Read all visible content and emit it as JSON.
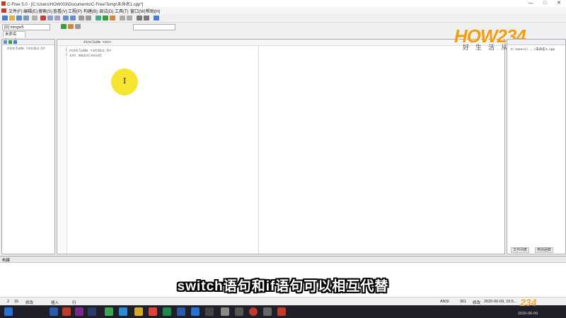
{
  "window": {
    "title": "C-Free 5.0 - [C:\\Users\\HOW003\\Documents\\C-Free\\Temp\\未命名1.cpp*]",
    "controls": [
      "—",
      "□",
      "✕"
    ]
  },
  "menu": {
    "items": [
      "文件(F)",
      "编辑(E)",
      "搜索(S)",
      "查看(V)",
      "工程(P)",
      "构建(B)",
      "调试(D)",
      "工具(T)",
      "窗口(W)",
      "帮助(H)"
    ]
  },
  "compiler_select": {
    "value": "[D] mingw5"
  },
  "file_tab": {
    "label": "未命名1.cpp*"
  },
  "left_panel": {
    "tree_item": "#include <stdio.h>"
  },
  "editor": {
    "scope_select": "#include <st>",
    "lines": [
      {
        "no": "1",
        "text": "#include <stdio.h>"
      },
      {
        "no": "2",
        "text": "int main(void)"
      }
    ]
  },
  "logo": {
    "text": "HOW234",
    "tagline": [
      "好",
      "生",
      "活",
      "从",
      "这",
      "里",
      "开",
      "始"
    ]
  },
  "right_panel": {
    "path": "C:\\Users\\...\\未命名1.cpp",
    "tabs": [
      "文件列表",
      "类别函数"
    ]
  },
  "bottom_panel": {
    "title": "构建"
  },
  "status_bar": {
    "line": "2",
    "col": "15",
    "modified": "修改",
    "insert": "插入",
    "row_label": "行",
    "encoding": "ANSI",
    "size": "301",
    "mod_label": "修改",
    "datetime": "2020-06-09, 16:5..."
  },
  "taskbar": {
    "date": "2020-06-09"
  },
  "subtitle": "switch语句和if语句可以相互代替",
  "watermark": "234"
}
